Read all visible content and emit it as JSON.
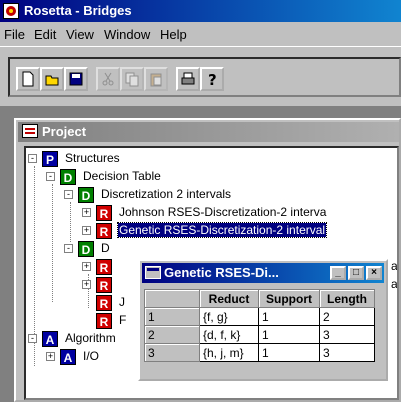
{
  "window": {
    "title": "Rosetta - Bridges"
  },
  "menu": [
    "File",
    "Edit",
    "View",
    "Window",
    "Help"
  ],
  "toolbar": {
    "buttons": [
      "new-icon",
      "open-icon",
      "save-icon",
      "cut-icon",
      "copy-icon",
      "paste-icon",
      "print-icon",
      "help-icon"
    ]
  },
  "project": {
    "title": "Project",
    "tree": [
      {
        "badge": "P",
        "label": "Structures",
        "expander": "-"
      },
      {
        "badge": "D",
        "label": "Decision Table",
        "expander": "-"
      },
      {
        "badge": "D",
        "label": "Discretization 2 intervals",
        "expander": "-"
      },
      {
        "badge": "R",
        "label": "Johnson RSES-Discretization-2 interva",
        "expander": "+"
      },
      {
        "badge": "R",
        "label": "Genetic RSES-Discretization-2 interval",
        "expander": "+",
        "selected": true
      },
      {
        "badge": "D",
        "label": "D",
        "expander": "-"
      },
      {
        "badge": "R",
        "label": "",
        "expander": "+",
        "trailing": "a"
      },
      {
        "badge": "R",
        "label": "",
        "expander": "+",
        "trailing": "al"
      },
      {
        "badge": "R",
        "label": "J",
        "expander": ""
      },
      {
        "badge": "R",
        "label": "F",
        "expander": ""
      },
      {
        "badge": "A",
        "label": "Algorithm",
        "expander": "-"
      },
      {
        "badge": "A",
        "label": "I/O",
        "expander": "+"
      }
    ]
  },
  "popup": {
    "title": "Genetic RSES-Di...",
    "buttons": {
      "minimize": "_",
      "maximize": "□",
      "close": "×"
    },
    "columns": [
      "",
      "Reduct",
      "Support",
      "Length"
    ],
    "rows": [
      {
        "id": "1",
        "reduct": "{f, g}",
        "support": "1",
        "length": "2"
      },
      {
        "id": "2",
        "reduct": "{d, f, k}",
        "support": "1",
        "length": "3"
      },
      {
        "id": "3",
        "reduct": "{h, j, m}",
        "support": "1",
        "length": "3"
      }
    ]
  }
}
